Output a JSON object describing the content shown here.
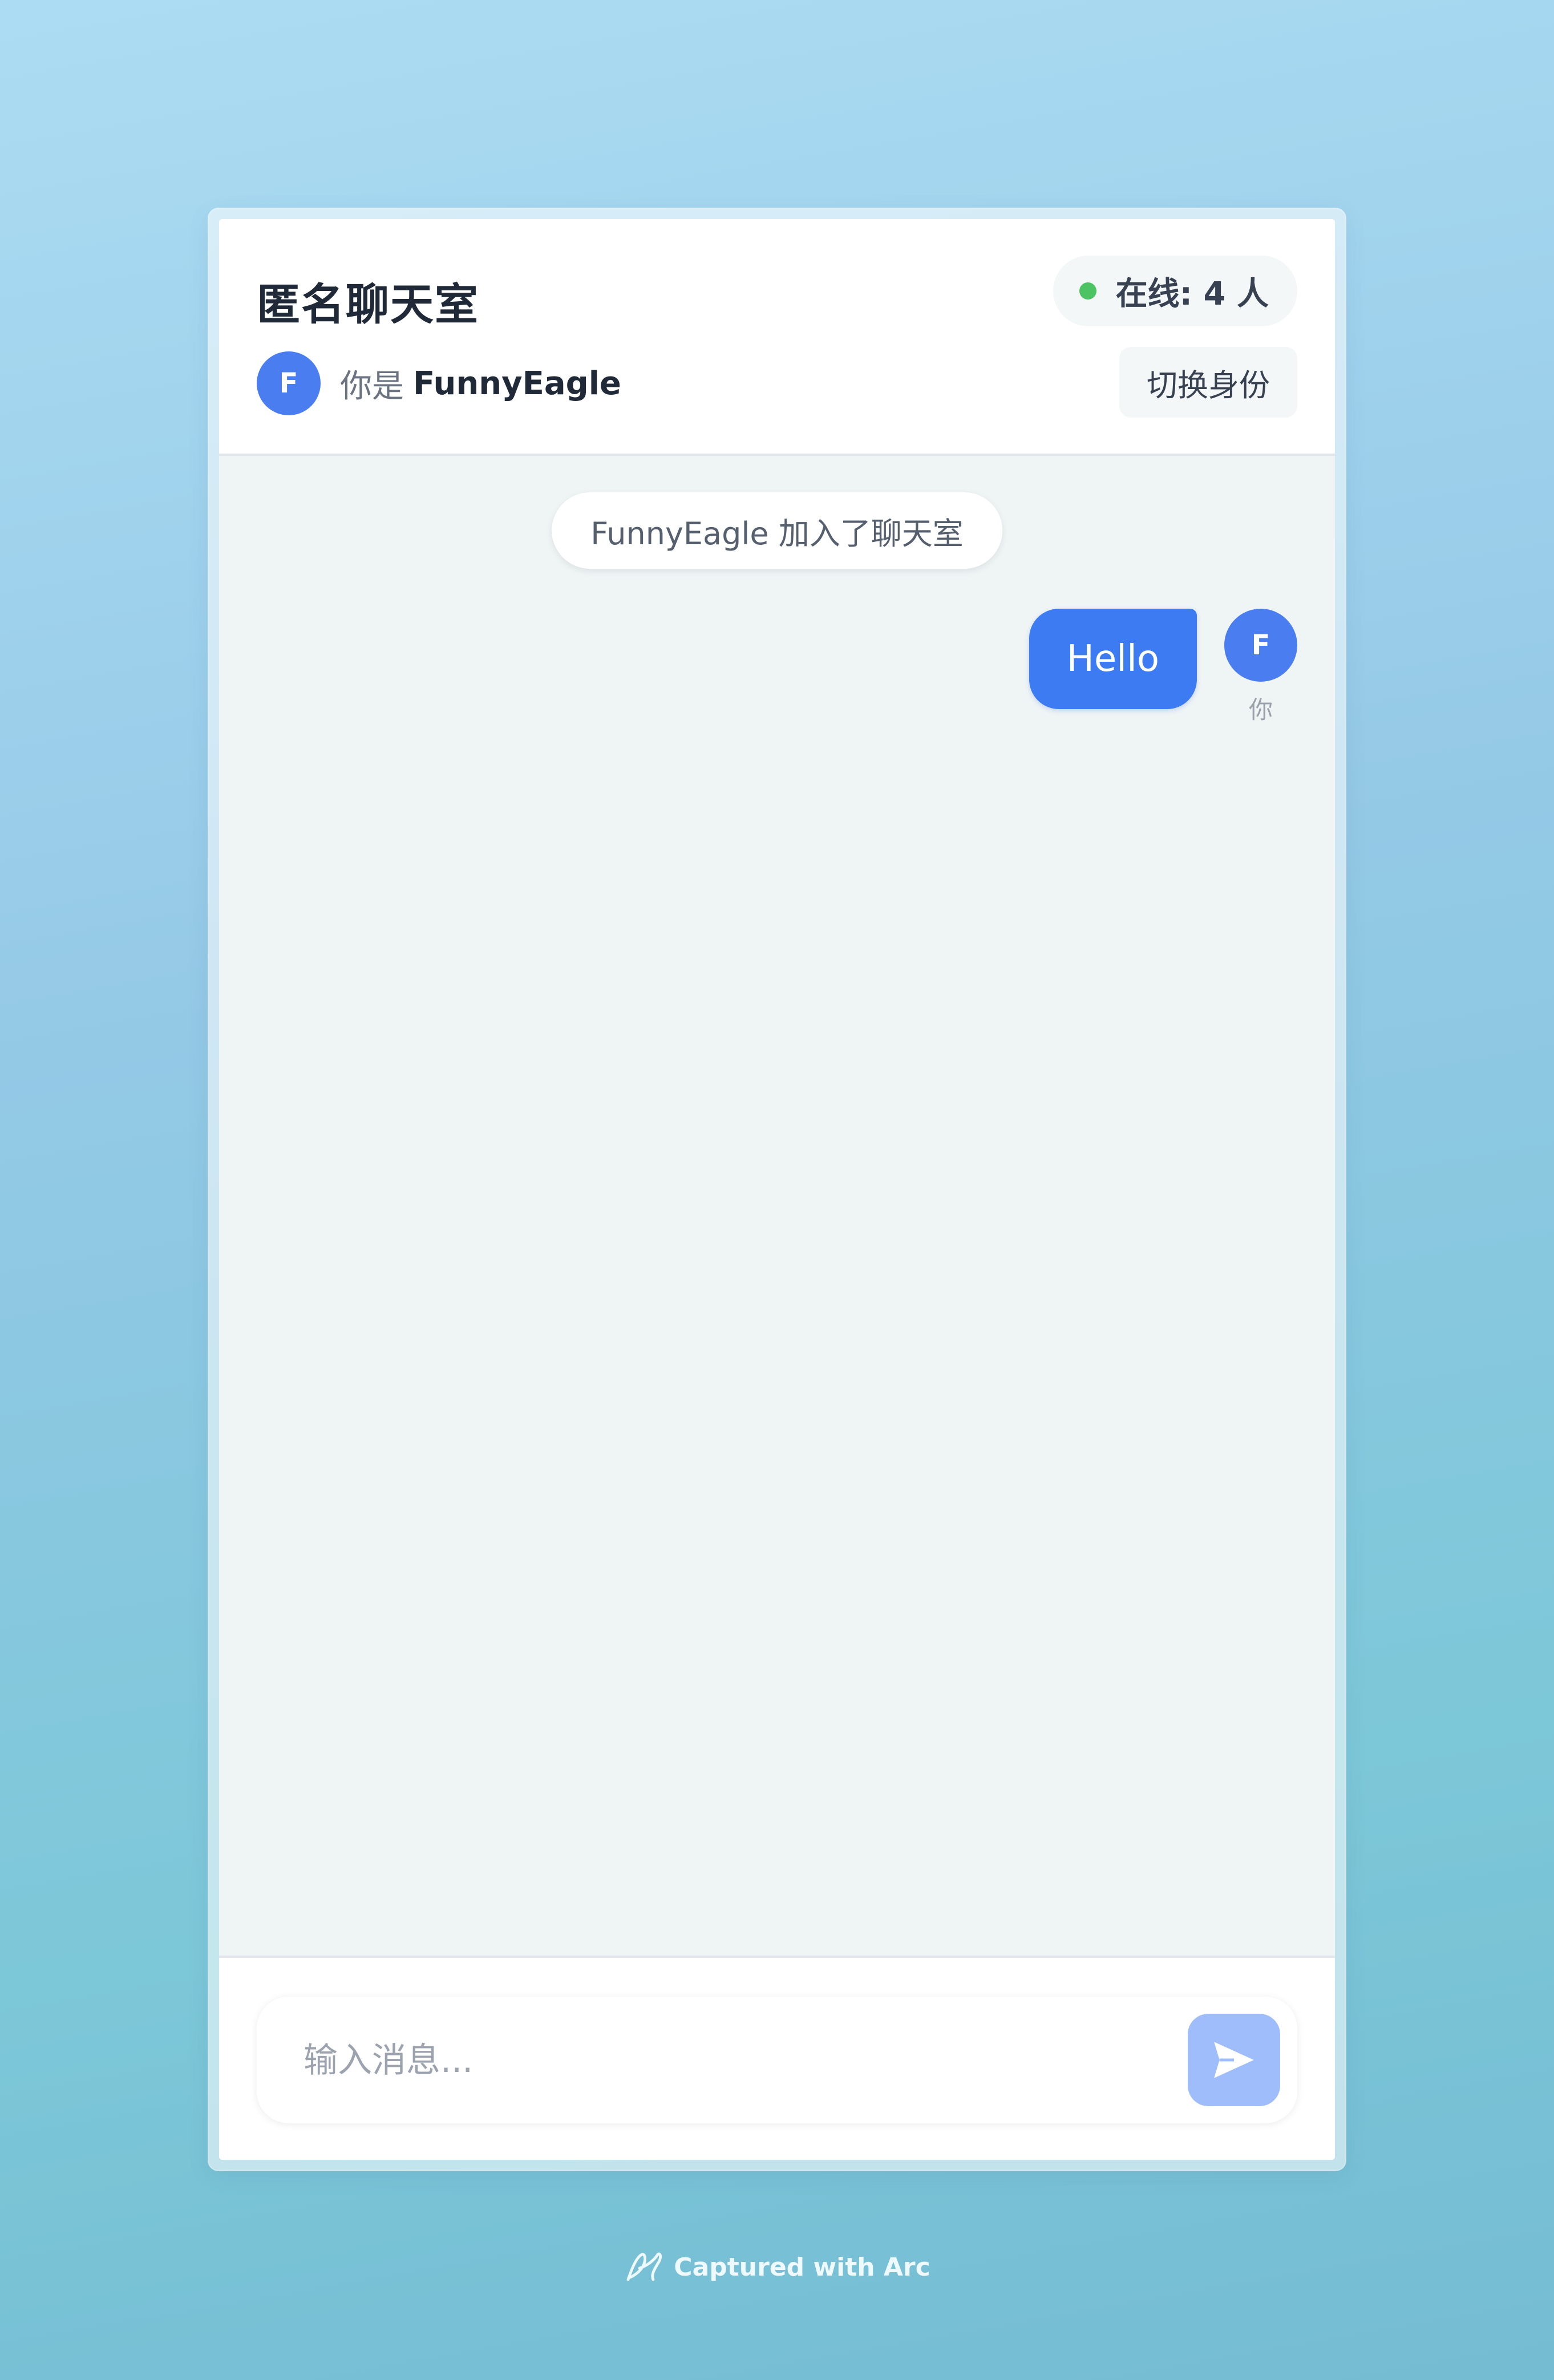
{
  "header": {
    "title": "匿名聊天室",
    "online_text": "在线: 4 人",
    "status_color": "#4cc463",
    "avatar_initial": "F",
    "you_prefix": "你是",
    "username": "FunnyEagle",
    "switch_label": "切换身份"
  },
  "messages": {
    "system_notice": "FunnyEagle 加入了聊天室",
    "items": [
      {
        "text": "Hello",
        "avatar_initial": "F",
        "sender_label": "你"
      }
    ]
  },
  "composer": {
    "placeholder": "输入消息...",
    "send_icon": "send-icon"
  },
  "footer": {
    "watermark": "Captured with Arc"
  },
  "colors": {
    "accent": "#3d7bf3",
    "send_button": "#9fbdfa"
  }
}
